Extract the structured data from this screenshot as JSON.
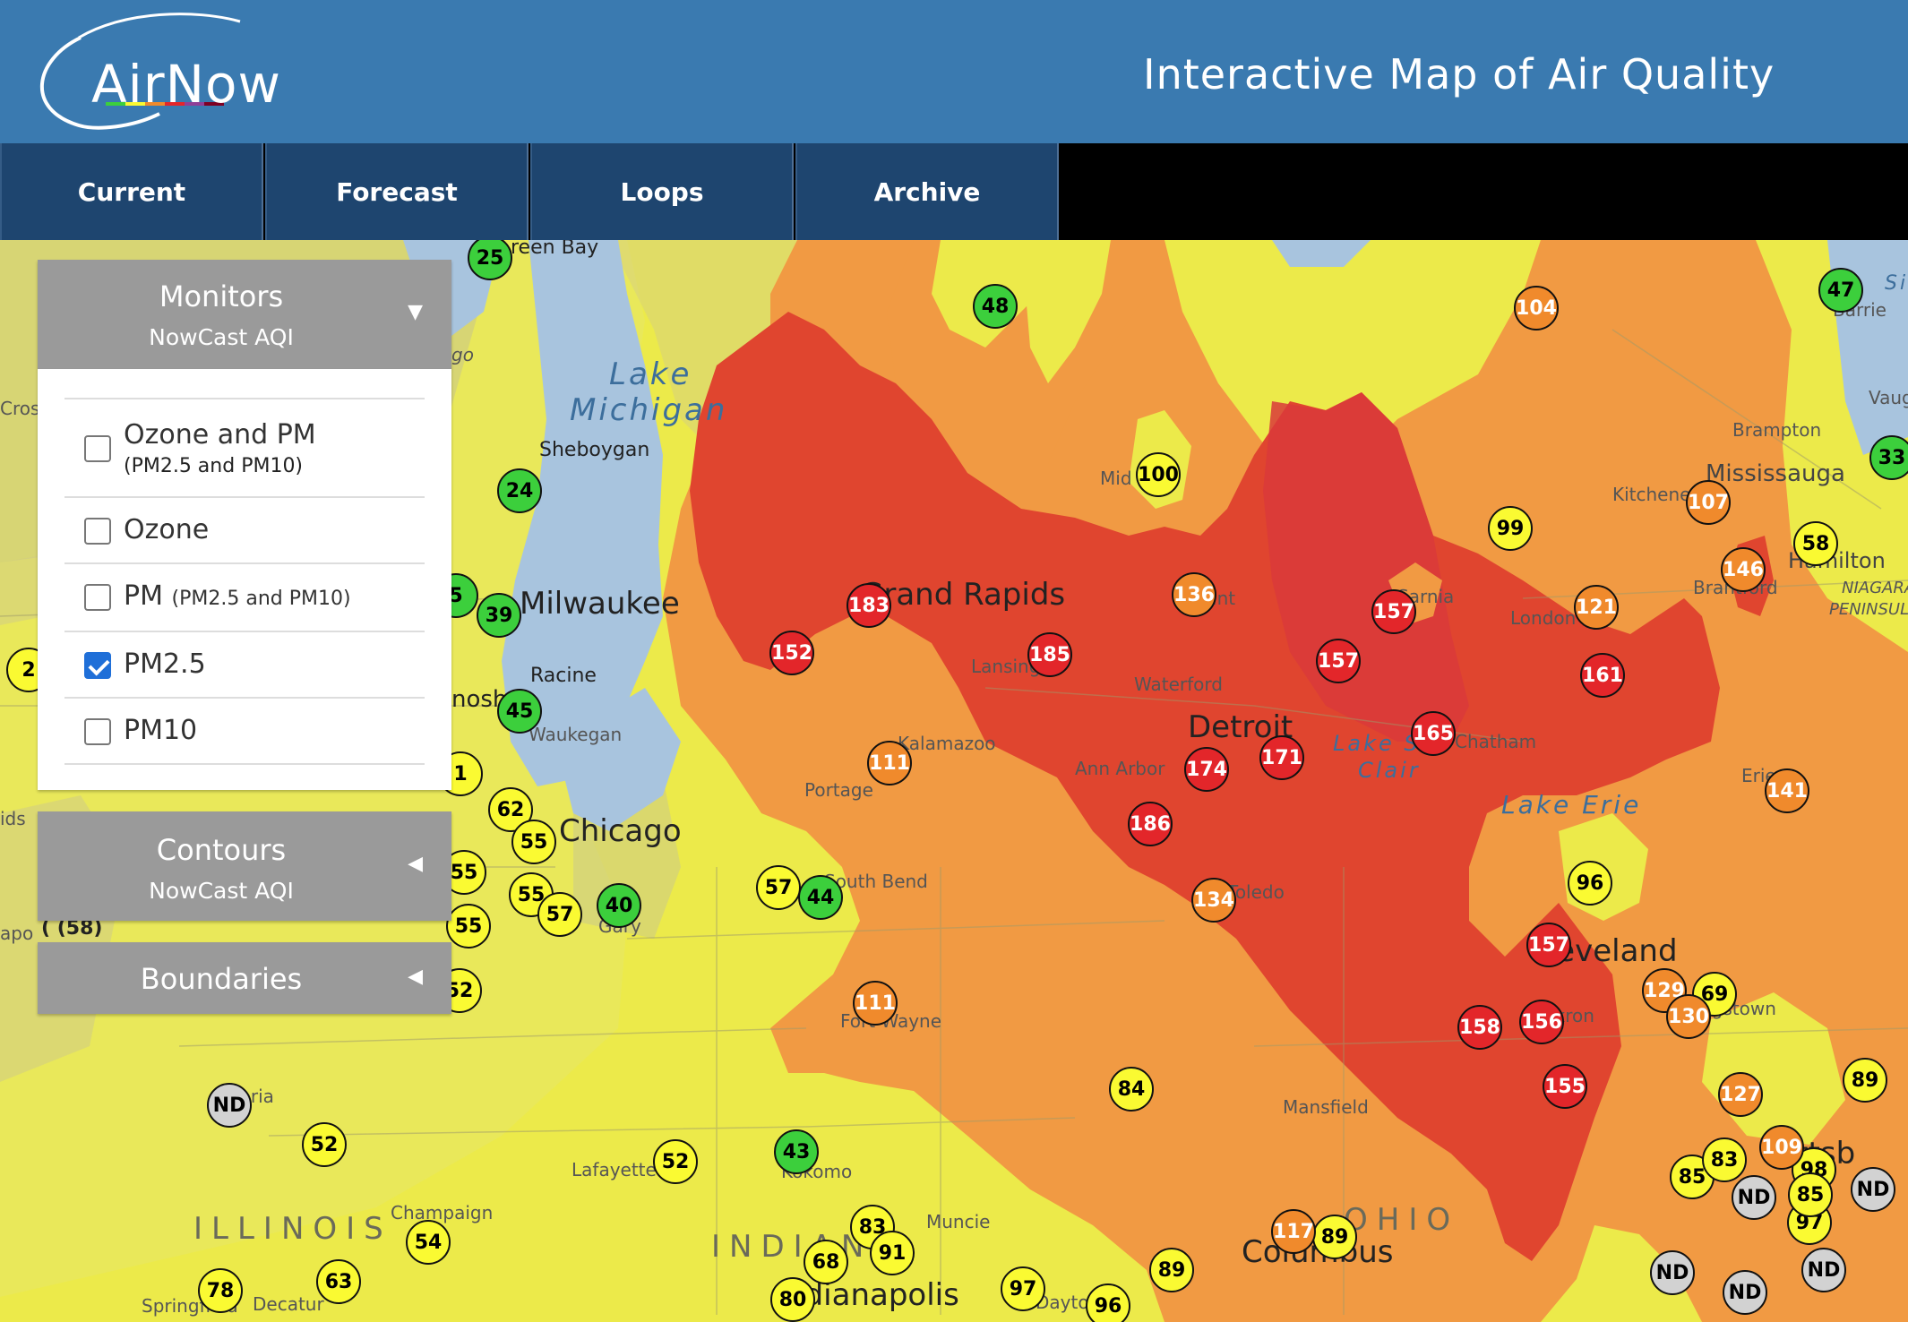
{
  "header": {
    "logo_text": "AirNow",
    "title": "Interactive Map of Air Quality"
  },
  "tabs": [
    {
      "label": "Current"
    },
    {
      "label": "Forecast"
    },
    {
      "label": "Loops"
    },
    {
      "label": "Archive"
    }
  ],
  "panel": {
    "monitors": {
      "title": "Monitors",
      "subtitle": "NowCast AQI",
      "expanded": true,
      "options": [
        {
          "label": "Ozone and PM",
          "sub": "(PM2.5 and PM10)",
          "checked": false
        },
        {
          "label": "Ozone",
          "sub": "",
          "checked": false
        },
        {
          "label": "PM",
          "sub": "(PM2.5 and PM10)",
          "checked": false
        },
        {
          "label": "PM2.5",
          "sub": "",
          "checked": true
        },
        {
          "label": "PM10",
          "sub": "",
          "checked": false
        }
      ]
    },
    "contours": {
      "title": "Contours",
      "subtitle": "NowCast AQI",
      "expanded": false
    },
    "boundaries": {
      "title": "Boundaries",
      "expanded": false
    }
  },
  "colors": {
    "good": "#3ccf3c",
    "moderate": "#fafa32",
    "usg": "#f08a2c",
    "unhealthy": "#e3262a",
    "no_data": "#d2d2d2",
    "header": "#3a7ab0",
    "tab": "#1e456f",
    "panel_head": "#9a9a9a"
  },
  "map_labels": {
    "green_bay": "reen Bay",
    "lake_michigan_1": "Lake",
    "lake_michigan_2": "Michigan",
    "sheboygan": "Sheboygan",
    "milwaukee": "Milwaukee",
    "racine": "Racine",
    "kenosha": "nosha",
    "waukegan": "Waukegan",
    "chicago": "Chicago",
    "gary": "Gary",
    "grand_rapids": "Grand Rapids",
    "lansing": "Lansing",
    "kalamazoo": "Kalamazoo",
    "portage": "Portage",
    "south_bend": "South Bend",
    "ann_arbor": "Ann Arbor",
    "waterford": "Waterford",
    "flint": "Flint",
    "midland": "Mid",
    "detroit": "Detroit",
    "lake_st_clair_1": "Lake St",
    "lake_st_clair_2": "Clair",
    "sarnia": "Sarnia",
    "london": "London",
    "chatham": "Chatham",
    "lake_erie": "Lake Erie",
    "erie": "Erie",
    "toledo": "Toledo",
    "cleveland": "Cleveland",
    "akron": "Akron",
    "youngstown": "ngstown",
    "mansfield": "Mansfield",
    "columbus": "Columbus",
    "ohio": "OHIO",
    "fort_wayne": "Fort Wayne",
    "lafayette": "Lafayette",
    "kokomo": "Kokomo",
    "muncie": "Muncie",
    "indiana": "INDIANA",
    "indianapolis": "Indianapolis",
    "illinois": "ILLINOIS",
    "peoria": "Peoria",
    "champaign": "Champaign",
    "springfield": "Springfield",
    "decatur": "Decatur",
    "dayton": "Dayton",
    "pittsburgh": "Pittsb",
    "brampton": "Brampton",
    "mississauga": "Mississauga",
    "kitchener": "Kitchener",
    "brantford": "Brantford",
    "hamilton": "Hamilton",
    "niagara_1": "NIAGARA",
    "niagara_2": "PENINSULA",
    "barrie": "Barrie",
    "vaughan": "Vaug",
    "lake_simcoe": "Si",
    "cross": "Cros",
    "ids": "ids",
    "apo": "apo",
    "t58": "( (58)",
    "go": "go"
  },
  "monitors": [
    {
      "v": "25",
      "c": "good"
    },
    {
      "v": "48",
      "c": "good"
    },
    {
      "v": "24",
      "c": "good"
    },
    {
      "v": "39",
      "c": "good"
    },
    {
      "v": "45",
      "c": "good"
    },
    {
      "v": "40",
      "c": "good"
    },
    {
      "v": "44",
      "c": "good"
    },
    {
      "v": "43",
      "c": "good"
    },
    {
      "v": "47",
      "c": "good"
    },
    {
      "v": "33",
      "c": "good"
    },
    {
      "v": "5",
      "c": "good"
    },
    {
      "v": "100",
      "c": "moderate"
    },
    {
      "v": "99",
      "c": "moderate"
    },
    {
      "v": "96",
      "c": "moderate"
    },
    {
      "v": "58",
      "c": "moderate"
    },
    {
      "v": "62",
      "c": "moderate"
    },
    {
      "v": "55",
      "c": "moderate"
    },
    {
      "v": "55",
      "c": "moderate"
    },
    {
      "v": "55",
      "c": "moderate"
    },
    {
      "v": "55",
      "c": "moderate"
    },
    {
      "v": "57",
      "c": "moderate"
    },
    {
      "v": "57",
      "c": "moderate"
    },
    {
      "v": "52",
      "c": "moderate"
    },
    {
      "v": "52",
      "c": "moderate"
    },
    {
      "v": "52",
      "c": "moderate"
    },
    {
      "v": "84",
      "c": "moderate"
    },
    {
      "v": "54",
      "c": "moderate"
    },
    {
      "v": "83",
      "c": "moderate"
    },
    {
      "v": "91",
      "c": "moderate"
    },
    {
      "v": "68",
      "c": "moderate"
    },
    {
      "v": "80",
      "c": "moderate"
    },
    {
      "v": "97",
      "c": "moderate"
    },
    {
      "v": "96",
      "c": "moderate"
    },
    {
      "v": "89",
      "c": "moderate"
    },
    {
      "v": "89",
      "c": "moderate"
    },
    {
      "v": "78",
      "c": "moderate"
    },
    {
      "v": "63",
      "c": "moderate"
    },
    {
      "v": "69",
      "c": "moderate"
    },
    {
      "v": "89",
      "c": "moderate"
    },
    {
      "v": "85",
      "c": "moderate"
    },
    {
      "v": "83",
      "c": "moderate"
    },
    {
      "v": "97",
      "c": "moderate"
    },
    {
      "v": "98",
      "c": "moderate"
    },
    {
      "v": "85",
      "c": "moderate"
    },
    {
      "v": "1",
      "c": "moderate"
    },
    {
      "v": "2",
      "c": "moderate"
    },
    {
      "v": "104",
      "c": "usg"
    },
    {
      "v": "136",
      "c": "usg"
    },
    {
      "v": "111",
      "c": "usg"
    },
    {
      "v": "111",
      "c": "usg"
    },
    {
      "v": "134",
      "c": "usg"
    },
    {
      "v": "107",
      "c": "usg"
    },
    {
      "v": "146",
      "c": "usg"
    },
    {
      "v": "121",
      "c": "usg"
    },
    {
      "v": "141",
      "c": "usg"
    },
    {
      "v": "129",
      "c": "usg"
    },
    {
      "v": "130",
      "c": "usg"
    },
    {
      "v": "127",
      "c": "usg"
    },
    {
      "v": "109",
      "c": "usg"
    },
    {
      "v": "117",
      "c": "usg"
    },
    {
      "v": "183",
      "c": "unhealthy"
    },
    {
      "v": "152",
      "c": "unhealthy"
    },
    {
      "v": "185",
      "c": "unhealthy"
    },
    {
      "v": "157",
      "c": "unhealthy"
    },
    {
      "v": "157",
      "c": "unhealthy"
    },
    {
      "v": "161",
      "c": "unhealthy"
    },
    {
      "v": "165",
      "c": "unhealthy"
    },
    {
      "v": "171",
      "c": "unhealthy"
    },
    {
      "v": "174",
      "c": "unhealthy"
    },
    {
      "v": "186",
      "c": "unhealthy"
    },
    {
      "v": "157",
      "c": "unhealthy"
    },
    {
      "v": "158",
      "c": "unhealthy"
    },
    {
      "v": "156",
      "c": "unhealthy"
    },
    {
      "v": "155",
      "c": "unhealthy"
    },
    {
      "v": "ND",
      "c": "nd"
    },
    {
      "v": "ND",
      "c": "nd"
    },
    {
      "v": "ND",
      "c": "nd"
    },
    {
      "v": "ND",
      "c": "nd"
    },
    {
      "v": "ND",
      "c": "nd"
    },
    {
      "v": "ND",
      "c": "nd"
    }
  ]
}
